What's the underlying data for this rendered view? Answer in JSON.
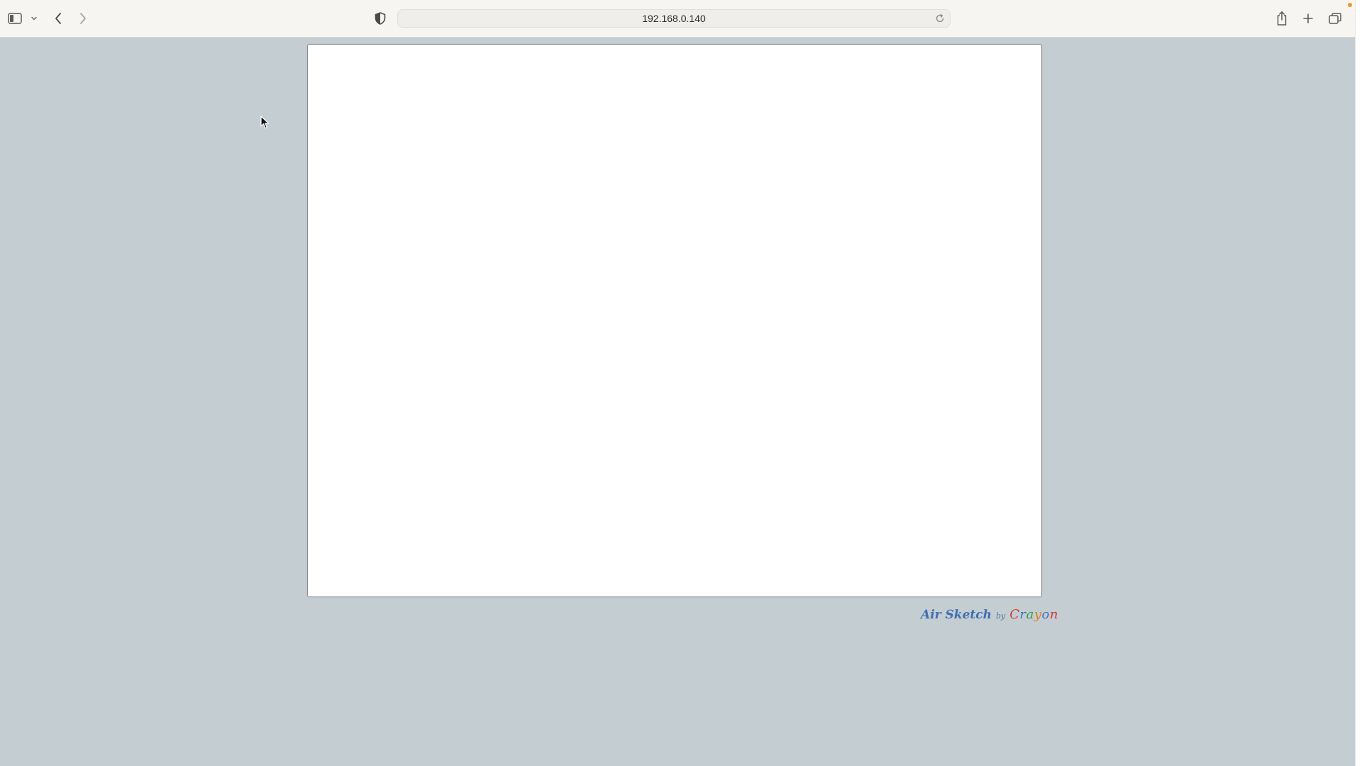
{
  "browser": {
    "address": "192.168.0.140",
    "icons": {
      "sidebar": "sidebar-icon",
      "sidebar_menu": "chevron-down-icon",
      "back": "chevron-left-icon",
      "forward": "chevron-right-icon",
      "privacy": "shield-icon",
      "reload": "reload-icon",
      "share": "share-icon",
      "new_tab": "plus-icon",
      "tab_overview": "tabs-icon"
    }
  },
  "page": {
    "branding": {
      "name": "Air Sketch",
      "by": "by",
      "company_letters": [
        "C",
        "r",
        "a",
        "y",
        "o",
        "n"
      ]
    }
  },
  "colors": {
    "page_background": "#c4cdd1",
    "toolbar_background": "#f6f5f1",
    "canvas_background": "#ffffff",
    "brand_blue": "#3f6fb2",
    "notification_dot": "#f0962c"
  }
}
